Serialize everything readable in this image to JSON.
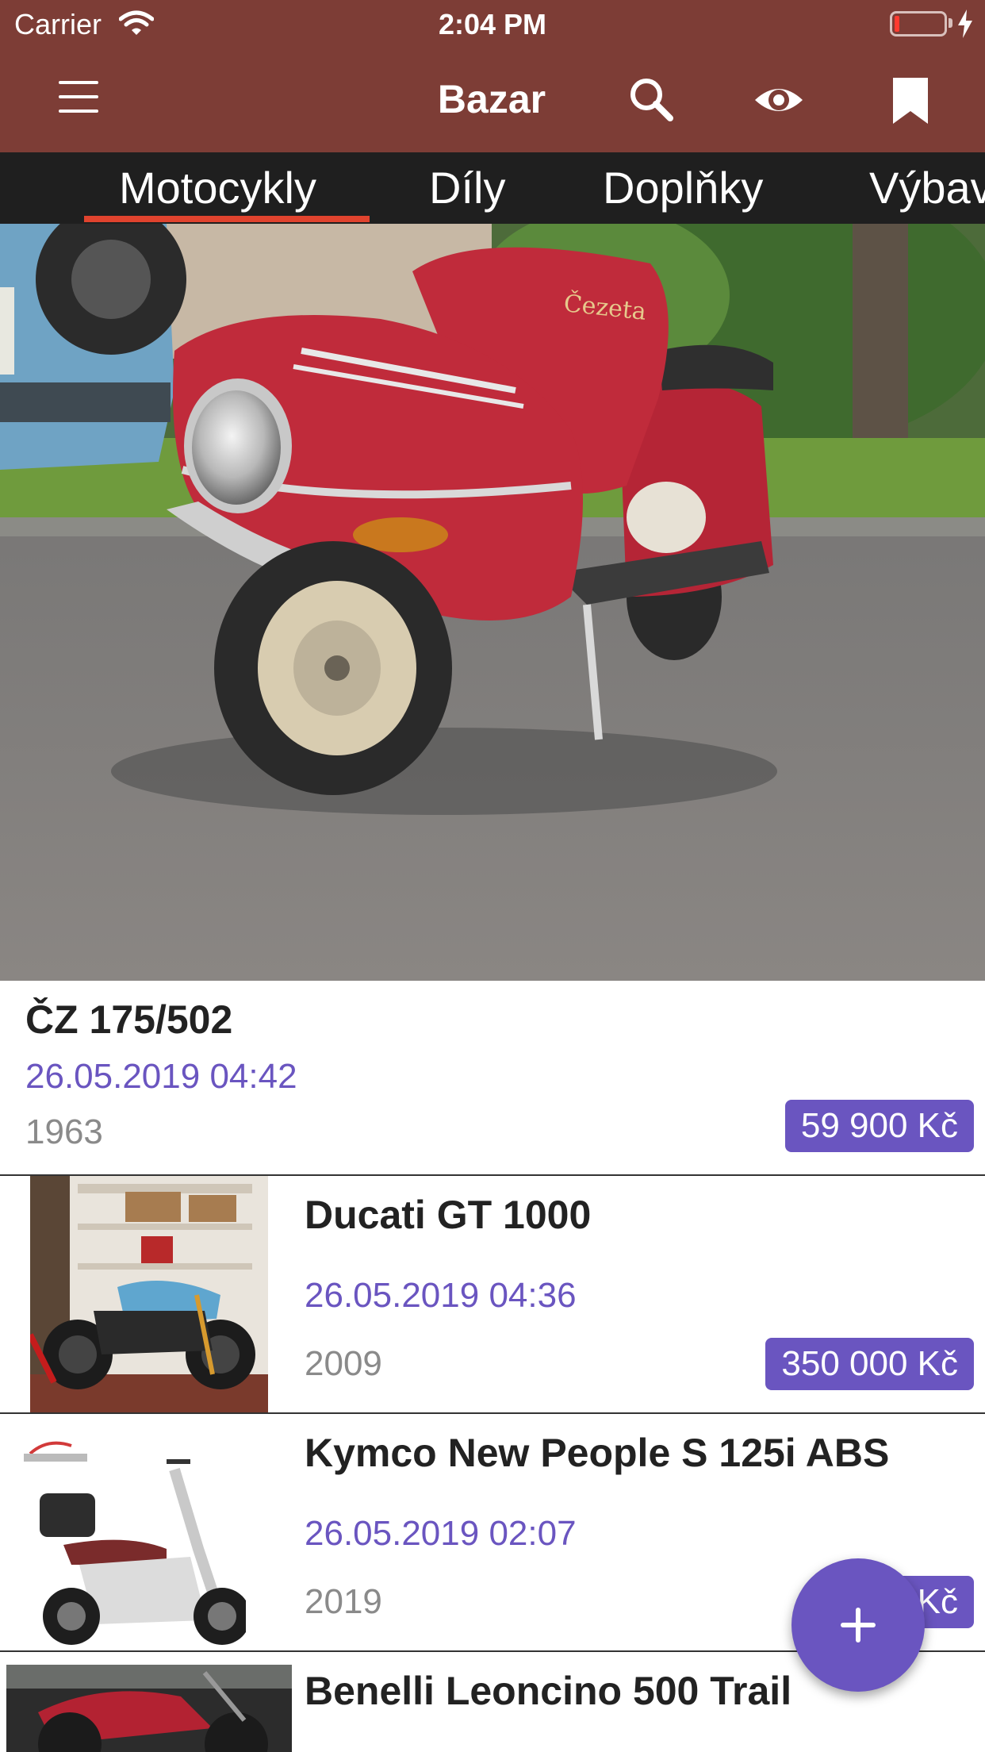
{
  "status_bar": {
    "carrier": "Carrier",
    "time": "2:04 PM"
  },
  "nav": {
    "title": "Bazar",
    "icons": [
      "menu-icon",
      "search-icon",
      "eye-icon",
      "bookmark-icon"
    ]
  },
  "tabs": [
    {
      "label": "Motocykly",
      "active": true
    },
    {
      "label": "Díly",
      "active": false
    },
    {
      "label": "Doplňky",
      "active": false
    },
    {
      "label": "Výbav",
      "active": false
    }
  ],
  "featured": {
    "title": "ČZ 175/502",
    "date": "26.05.2019 04:42",
    "year": "1963",
    "price": "59 900 Kč"
  },
  "listings": [
    {
      "title": "Ducati GT 1000",
      "date": "26.05.2019 04:36",
      "year": "2009",
      "price": "350 000 Kč"
    },
    {
      "title": "Kymco New People S 125i ABS",
      "date": "26.05.2019 02:07",
      "year": "2019",
      "price": "8… Kč"
    },
    {
      "title": "Benelli Leoncino 500 Trail",
      "date": "",
      "year": "",
      "price": ""
    }
  ],
  "colors": {
    "header": "#7d3d36",
    "tabs_bg": "#1f1f1f",
    "tab_indicator": "#e0432e",
    "accent": "#6a55c0"
  }
}
